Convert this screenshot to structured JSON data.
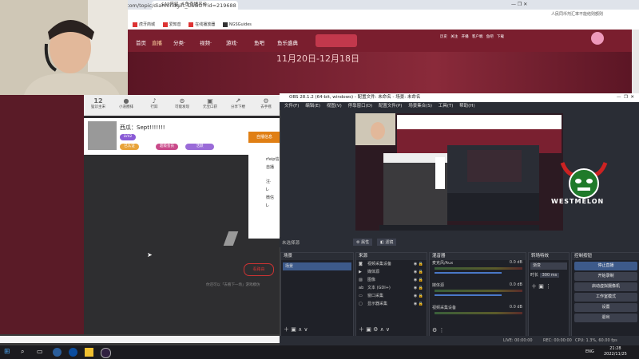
{
  "browser": {
    "tab_title": "$All停留_斗鱼直播平台",
    "url": "com/topic/diamondgift_CSGO?rid=219688",
    "top_notice": "人民同币剂汇率不能结则额则",
    "bookmarks": [
      "虎牙商城",
      "爱知音",
      "在线播放器",
      "NGSGuides"
    ]
  },
  "site": {
    "nav": [
      "首页",
      "直播",
      "分类·",
      "视频·",
      "游戏·",
      "鱼吧",
      "鱼乐盛典"
    ],
    "right_icons": [
      "历史",
      "关注",
      "开播",
      "客户端",
      "鱼吧",
      "下载"
    ],
    "banner_date": "11月20日-12月18日",
    "room_icons": [
      {
        "num": "12",
        "label": "猛诊主宋"
      },
      {
        "num": "",
        "label": "小道圈排"
      },
      {
        "num": "",
        "label": "行踪"
      },
      {
        "num": "",
        "label": "可能发现"
      },
      {
        "num": "",
        "label": "元宝口获"
      },
      {
        "num": "",
        "label": "分享下楼"
      },
      {
        "num": "",
        "label": "去手摇"
      }
    ],
    "streamer_name": "西瓜：Sept!!!!!!!",
    "streamer_tags": [
      "LV42",
      "已认证",
      "超级会员",
      "活跃"
    ],
    "popup_title": "自播信息",
    "popup_lines": [
      "rfeip信",
      "自播",
      "注·",
      "L·",
      "微信",
      "L·"
    ],
    "prev_button": "看路由",
    "hint": "你还可以「去看下一场」游戏模仿"
  },
  "obs": {
    "title": "OBS 28.1.2 (64-bit, windows) - 配置文件: 未命名 - 场景: 未命名",
    "menu": [
      "文件(F)",
      "编辑(E)",
      "视图(V)",
      "停靠窗口(D)",
      "配置文件(P)",
      "场景集合(S)",
      "工具(T)",
      "帮助(H)"
    ],
    "no_scene": "未选择源",
    "props_btn": "属性",
    "filter_btn": "滤镜",
    "docks": {
      "scenes": {
        "title": "场景",
        "items": [
          "场景"
        ]
      },
      "sources": {
        "title": "来源",
        "items": [
          "视频采集设备",
          "媒体源",
          "图像",
          "文本 (GDI+)",
          "窗口采集",
          "显示器采集"
        ]
      },
      "mixer": {
        "title": "混音器",
        "channels": [
          {
            "name": "麦克风/Aux",
            "db": "0.0 dB"
          },
          {
            "name": "媒体源",
            "db": "0.0 dB"
          },
          {
            "name": "视频采集设备",
            "db": "0.0 dB"
          }
        ]
      },
      "transitions": {
        "title": "转场特效",
        "type": "渐变",
        "duration_label": "时长",
        "duration": "300 ms"
      },
      "controls": {
        "title": "控制按钮",
        "buttons": [
          "停止直播",
          "开始录制",
          "启动虚拟摄像机",
          "工作室模式",
          "设置",
          "退出"
        ]
      }
    },
    "status": {
      "live": "LIVE: 00:00:00",
      "rec": "REC: 00:00:00",
      "cpu": "CPU: 1.3%, 60.00 fps"
    },
    "watermark_text": "WESTMELON"
  },
  "taskbar": {
    "lang": "ENG",
    "time": "21:28",
    "date": "2022/11/25"
  }
}
